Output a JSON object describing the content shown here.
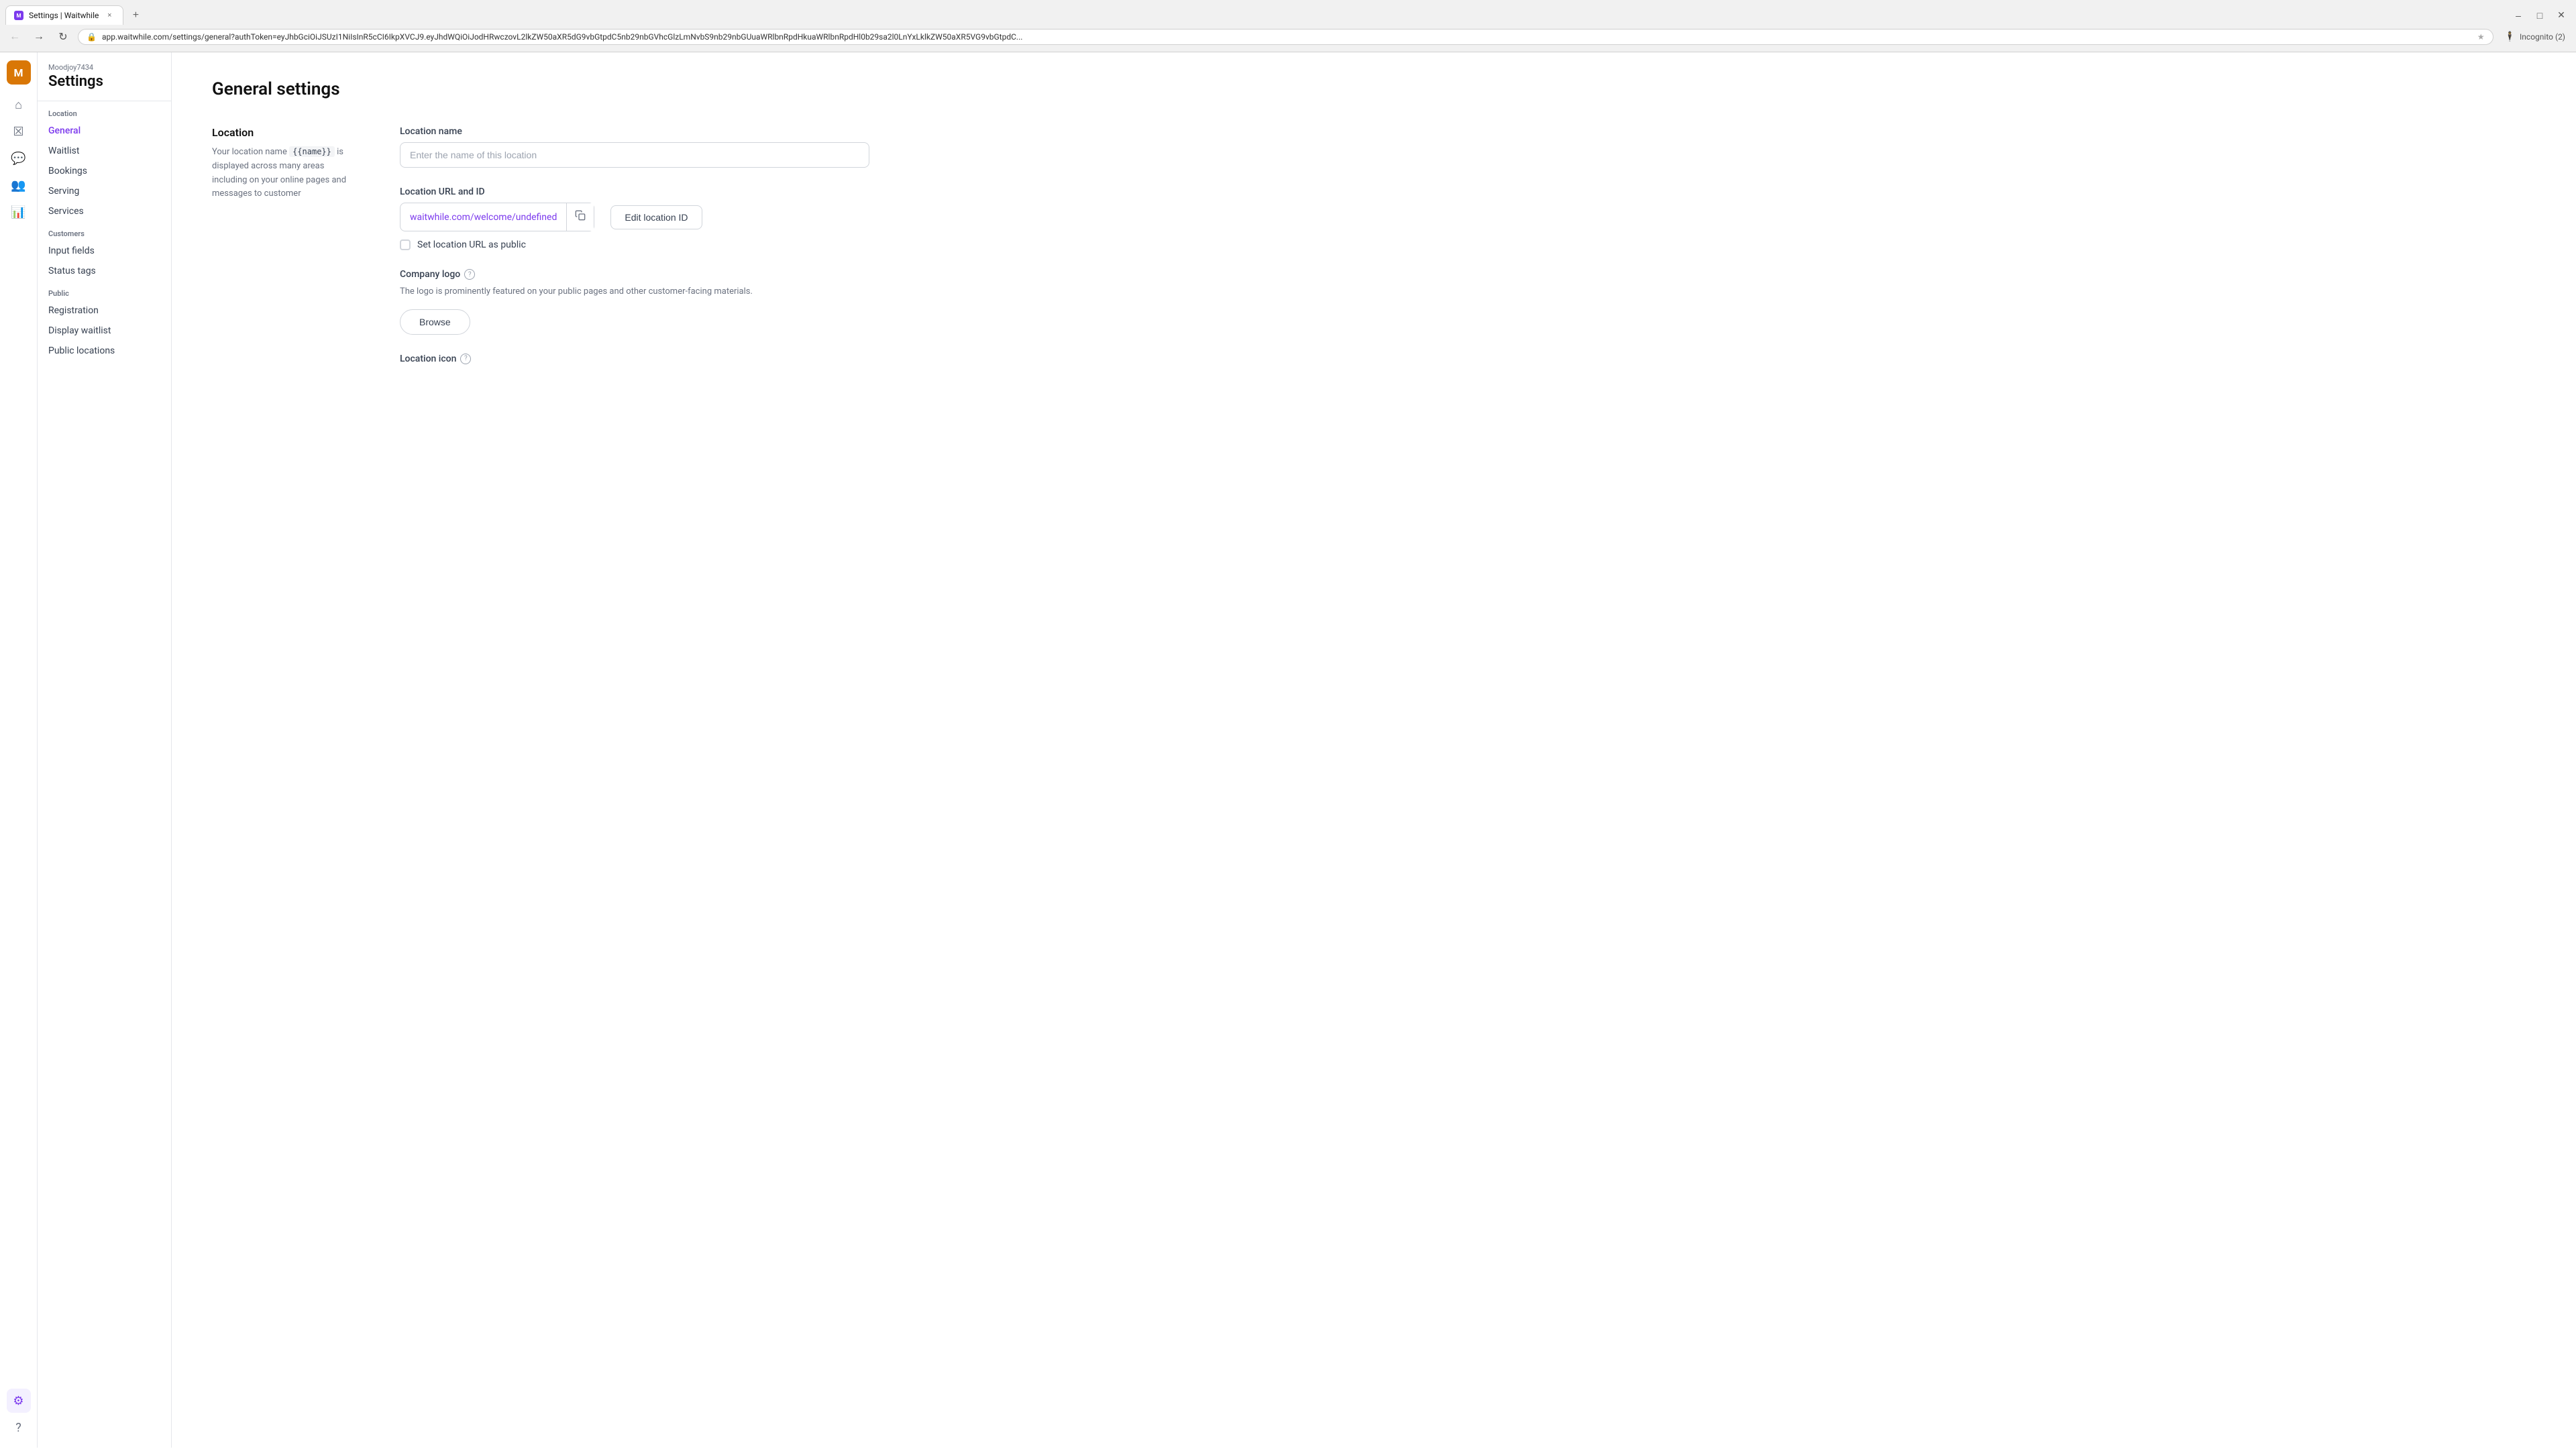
{
  "browser": {
    "tab_title": "Settings | Waitwhile",
    "tab_favicon": "M",
    "url": "app.waitwhile.com/settings/general?authToken=eyJhbGciOiJSUzI1NiIsInR5cCI6IkpXVCJ9.eyJhdWQiOiJodHRwczovL2lkZW50aXR5dG9vbGtpdC5nb29nbGVhcGlzLmNvbS9nb29nbGUuaWRlbnRpdHkuaWRlbnRpdHl0b29sa2l0LnYxLklkZW50aXR5VG9vbGtpdC...",
    "incognito_label": "Incognito (2)"
  },
  "app": {
    "user_initial": "M",
    "username": "Moodjoy7434",
    "settings_title": "Settings"
  },
  "sidebar": {
    "location_section": "Location",
    "items": [
      {
        "label": "General",
        "active": true
      },
      {
        "label": "Waitlist",
        "active": false
      },
      {
        "label": "Bookings",
        "active": false
      },
      {
        "label": "Serving",
        "active": false
      },
      {
        "label": "Services",
        "active": false
      }
    ],
    "customers_section": "Customers",
    "customer_items": [
      {
        "label": "Input fields",
        "active": false
      },
      {
        "label": "Status tags",
        "active": false
      }
    ],
    "public_section": "Public",
    "public_items": [
      {
        "label": "Registration",
        "active": false
      },
      {
        "label": "Display waitlist",
        "active": false
      },
      {
        "label": "Public locations",
        "active": false
      }
    ]
  },
  "main": {
    "page_title": "General settings",
    "location_section": {
      "heading": "Location",
      "description_1": "Your location name",
      "template_tag": "{{name}}",
      "description_2": " is displayed across many areas including on your online pages and messages to customer"
    },
    "location_name": {
      "label": "Location name",
      "placeholder": "Enter the name of this location"
    },
    "location_url": {
      "label": "Location URL and ID",
      "url": "waitwhile.com/welcome/undefined",
      "copy_tooltip": "Copy",
      "edit_button": "Edit location ID",
      "public_checkbox": "Set location URL as public"
    },
    "company_logo": {
      "label": "Company logo",
      "description": "The logo is prominently featured on your public pages and other customer-facing materials.",
      "browse_button": "Browse"
    },
    "location_icon": {
      "label": "Location icon"
    }
  }
}
